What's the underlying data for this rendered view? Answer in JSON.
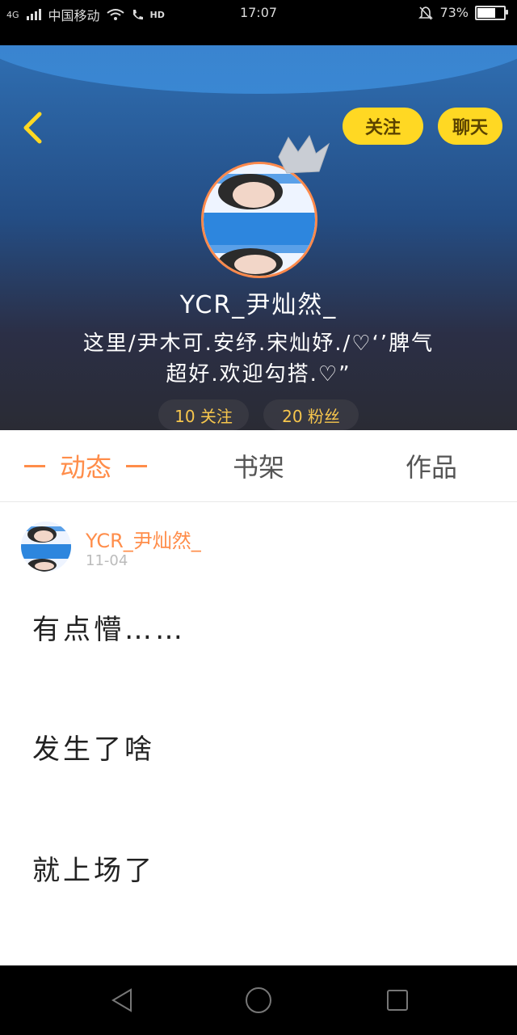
{
  "status_bar": {
    "carrier": "中国移动",
    "network": "4G",
    "hd": "HD",
    "time": "17:07",
    "battery": "73%",
    "battery_level": 0.73
  },
  "header": {
    "follow_button": "关注",
    "chat_button": "聊天",
    "username": "YCR_尹灿然_",
    "bio_line1": "这里/尹木可.安纾.宋灿妤./♡‘’脾气",
    "bio_line2": "超好.欢迎勾搭.♡”",
    "following_label": "10 关注",
    "fans_label": "20 粉丝"
  },
  "tabs": {
    "active": "动态",
    "shelf": "书架",
    "works": "作品"
  },
  "post": {
    "author": "YCR_尹灿然_",
    "date": "11-04",
    "line1": "有点懵……",
    "line2": "发生了啥",
    "line3": "就上场了"
  },
  "colors": {
    "accent": "#ff8d4a",
    "button_yellow": "#ffd823",
    "stat_text": "#f6c64d"
  },
  "icons": {
    "back": "chevron-left-icon",
    "nav_back": "triangle-back-icon",
    "nav_home": "circle-home-icon",
    "nav_recent": "square-recent-icon"
  }
}
